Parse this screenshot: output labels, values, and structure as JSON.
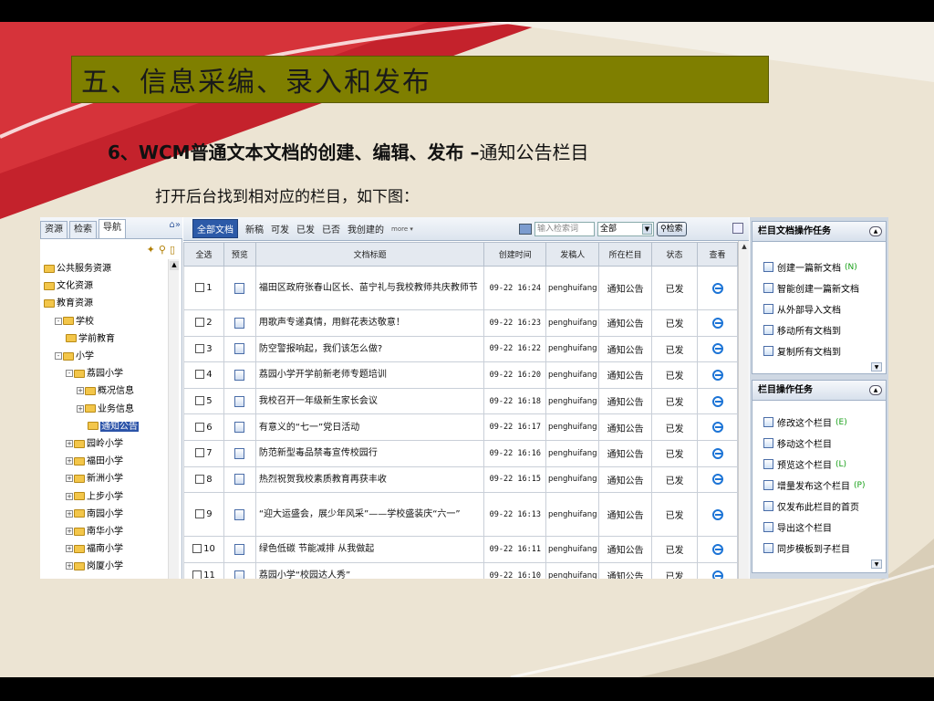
{
  "slide": {
    "title": "五、信息采编、录入和发布",
    "subtitle_bold": "6、WCM普通文本文档的创建、编辑、发布 –",
    "subtitle_light": "通知公告栏目",
    "note": "打开后台找到相对应的栏目，如下图："
  },
  "left_nav": {
    "tabs": [
      "资源",
      "检索",
      "导航"
    ],
    "tree": [
      {
        "label": "公共服务资源",
        "expander": ""
      },
      {
        "label": "文化资源",
        "expander": ""
      },
      {
        "label": "教育资源",
        "expander": ""
      },
      {
        "label": "学校",
        "expander": "-"
      },
      {
        "label": "学前教育",
        "expander": ""
      },
      {
        "label": "小学",
        "expander": "-"
      },
      {
        "label": "荔园小学",
        "expander": "-"
      },
      {
        "label": "概况信息",
        "expander": "+"
      },
      {
        "label": "业务信息",
        "expander": "+"
      },
      {
        "label": "通知公告",
        "expander": ""
      },
      {
        "label": "园岭小学",
        "expander": "+"
      },
      {
        "label": "福田小学",
        "expander": "+"
      },
      {
        "label": "新洲小学",
        "expander": "+"
      },
      {
        "label": "上步小学",
        "expander": "+"
      },
      {
        "label": "南园小学",
        "expander": "+"
      },
      {
        "label": "南华小学",
        "expander": "+"
      },
      {
        "label": "福南小学",
        "expander": "+"
      },
      {
        "label": "岗厦小学",
        "expander": "+"
      }
    ]
  },
  "toolbar": {
    "filters": [
      "全部文档",
      "新稿",
      "可发",
      "已发",
      "已否",
      "我创建的"
    ],
    "more": "more",
    "search_placeholder": "输入检索词",
    "scope": "全部",
    "search_button": "检索"
  },
  "table": {
    "headers": [
      "全选",
      "预览",
      "文档标题",
      "创建时间",
      "发稿人",
      "所在栏目",
      "状态",
      "查看"
    ],
    "rows": [
      {
        "no": "1",
        "title": "福田区政府张春山区长、苗宁礼与我校教师共庆教师节",
        "time": "09-22 16:24",
        "author": "penghuifang",
        "column": "通知公告",
        "status": "已发"
      },
      {
        "no": "2",
        "title": "用歌声专递真情，用鲜花表达敬意！",
        "time": "09-22 16:23",
        "author": "penghuifang",
        "column": "通知公告",
        "status": "已发"
      },
      {
        "no": "3",
        "title": "防空警报响起，我们该怎么做?",
        "time": "09-22 16:22",
        "author": "penghuifang",
        "column": "通知公告",
        "status": "已发"
      },
      {
        "no": "4",
        "title": "荔园小学开学前新老师专题培训",
        "time": "09-22 16:20",
        "author": "penghuifang",
        "column": "通知公告",
        "status": "已发"
      },
      {
        "no": "5",
        "title": "我校召开一年级新生家长会议",
        "time": "09-22 16:18",
        "author": "penghuifang",
        "column": "通知公告",
        "status": "已发"
      },
      {
        "no": "6",
        "title": "有意义的“七一”党日活动",
        "time": "09-22 16:17",
        "author": "penghuifang",
        "column": "通知公告",
        "status": "已发"
      },
      {
        "no": "7",
        "title": "防范新型毒品禁毒宣传校园行",
        "time": "09-22 16:16",
        "author": "penghuifang",
        "column": "通知公告",
        "status": "已发"
      },
      {
        "no": "8",
        "title": "热烈祝贺我校素质教育再获丰收",
        "time": "09-22 16:15",
        "author": "penghuifang",
        "column": "通知公告",
        "status": "已发"
      },
      {
        "no": "9",
        "title": "“迎大运盛会，展少年风采”——学校盛装庆“六一”",
        "time": "09-22 16:13",
        "author": "penghuifang",
        "column": "通知公告",
        "status": "已发"
      },
      {
        "no": "10",
        "title": "绿色低碳 节能减排 从我做起",
        "time": "09-22 16:11",
        "author": "penghuifang",
        "column": "通知公告",
        "status": "已发"
      },
      {
        "no": "11",
        "title": "荔园小学“校园达人秀”",
        "time": "09-22 16:10",
        "author": "penghuifang",
        "column": "通知公告",
        "status": "已发"
      }
    ]
  },
  "right_panel": {
    "doc_tasks_title": "栏目文档操作任务",
    "doc_tasks": [
      {
        "label": "创建一篇新文档",
        "shortcut": "(N)"
      },
      {
        "label": "智能创建一篇新文档",
        "shortcut": ""
      },
      {
        "label": "从外部导入文档",
        "shortcut": ""
      },
      {
        "label": "移动所有文档到",
        "shortcut": ""
      },
      {
        "label": "复制所有文档到",
        "shortcut": ""
      }
    ],
    "col_tasks_title": "栏目操作任务",
    "col_tasks": [
      {
        "label": "修改这个栏目",
        "shortcut": "(E)"
      },
      {
        "label": "移动这个栏目",
        "shortcut": ""
      },
      {
        "label": "预览这个栏目",
        "shortcut": "(L)"
      },
      {
        "label": "增量发布这个栏目",
        "shortcut": "(P)"
      },
      {
        "label": "仅发布此栏目的首页",
        "shortcut": ""
      },
      {
        "label": "导出这个栏目",
        "shortcut": ""
      },
      {
        "label": "同步模板到子栏目",
        "shortcut": ""
      }
    ]
  }
}
